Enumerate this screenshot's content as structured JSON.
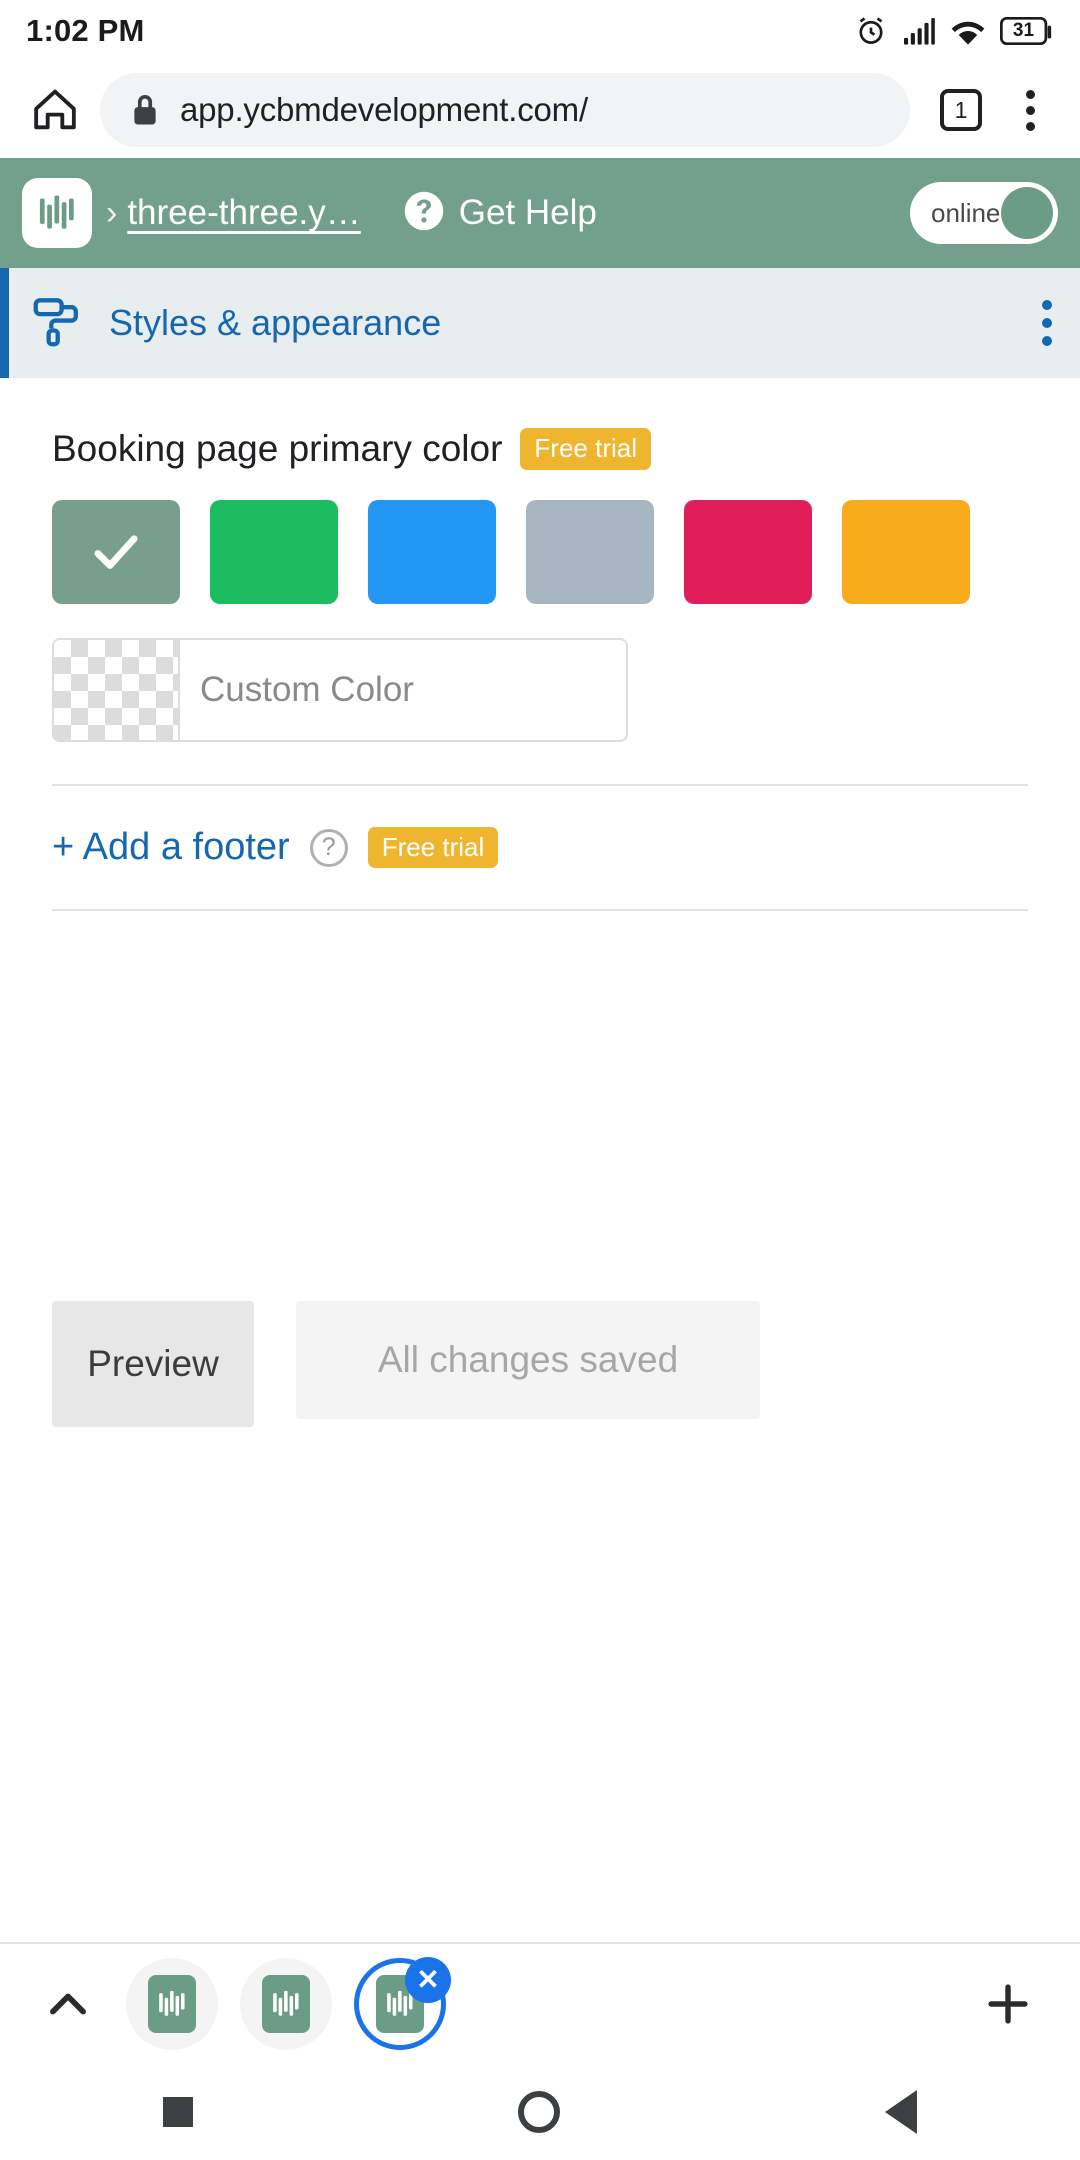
{
  "status_bar": {
    "time": "1:02 PM",
    "battery_percent": "31",
    "icons": [
      "alarm-icon",
      "cellular-signal-icon",
      "wifi-icon",
      "battery-icon"
    ]
  },
  "browser": {
    "home_icon": "home-icon",
    "lock_icon": "lock-icon",
    "url": "app.ycbmdevelopment.com/",
    "tab_count": "1",
    "menu_icon": "kebab-menu-icon"
  },
  "app_header": {
    "logo_icon": "ycbm-logo-icon",
    "separator": "›",
    "breadcrumb": "three-three.y…",
    "help_icon": "question-mark-icon",
    "help_label": "Get Help",
    "toggle_label": "online",
    "toggle_state": "on",
    "background_color": "#73a08d"
  },
  "section": {
    "icon": "paint-roller-icon",
    "title": "Styles & appearance",
    "accent_color": "#1567b0",
    "background_color": "#e8edf0",
    "menu_icon": "kebab-menu-icon"
  },
  "primary_color": {
    "label": "Booking page primary color",
    "badge": "Free trial",
    "badge_color": "#f0b52e",
    "swatches": [
      {
        "name": "sage-green",
        "hex": "#789e8d",
        "selected": true
      },
      {
        "name": "green",
        "hex": "#1cbc60",
        "selected": false
      },
      {
        "name": "blue",
        "hex": "#2296f3",
        "selected": false
      },
      {
        "name": "slate-gray",
        "hex": "#a7b6c2",
        "selected": false
      },
      {
        "name": "crimson",
        "hex": "#e01e5a",
        "selected": false
      },
      {
        "name": "amber",
        "hex": "#f9ab1b",
        "selected": false
      }
    ],
    "custom_color_placeholder": "Custom Color",
    "custom_color_value": ""
  },
  "footer_section": {
    "add_footer_label": "+ Add a footer",
    "help_icon": "question-mark-circle-icon",
    "help_glyph": "?",
    "badge": "Free trial"
  },
  "actions": {
    "preview_label": "Preview",
    "save_status_label": "All changes saved"
  },
  "tabstrip": {
    "collapse_icon": "chevron-up-icon",
    "new_tab_icon": "plus-icon",
    "tabs": [
      {
        "name": "tab-1",
        "icon": "ycbm-logo-icon",
        "active": false
      },
      {
        "name": "tab-2",
        "icon": "ycbm-logo-icon",
        "active": false
      },
      {
        "name": "tab-3",
        "icon": "ycbm-logo-icon",
        "active": true,
        "close_glyph": "✕"
      }
    ]
  },
  "nav_bar": {
    "recents_icon": "square-recents-icon",
    "home_icon": "circle-home-icon",
    "back_icon": "triangle-back-icon"
  }
}
